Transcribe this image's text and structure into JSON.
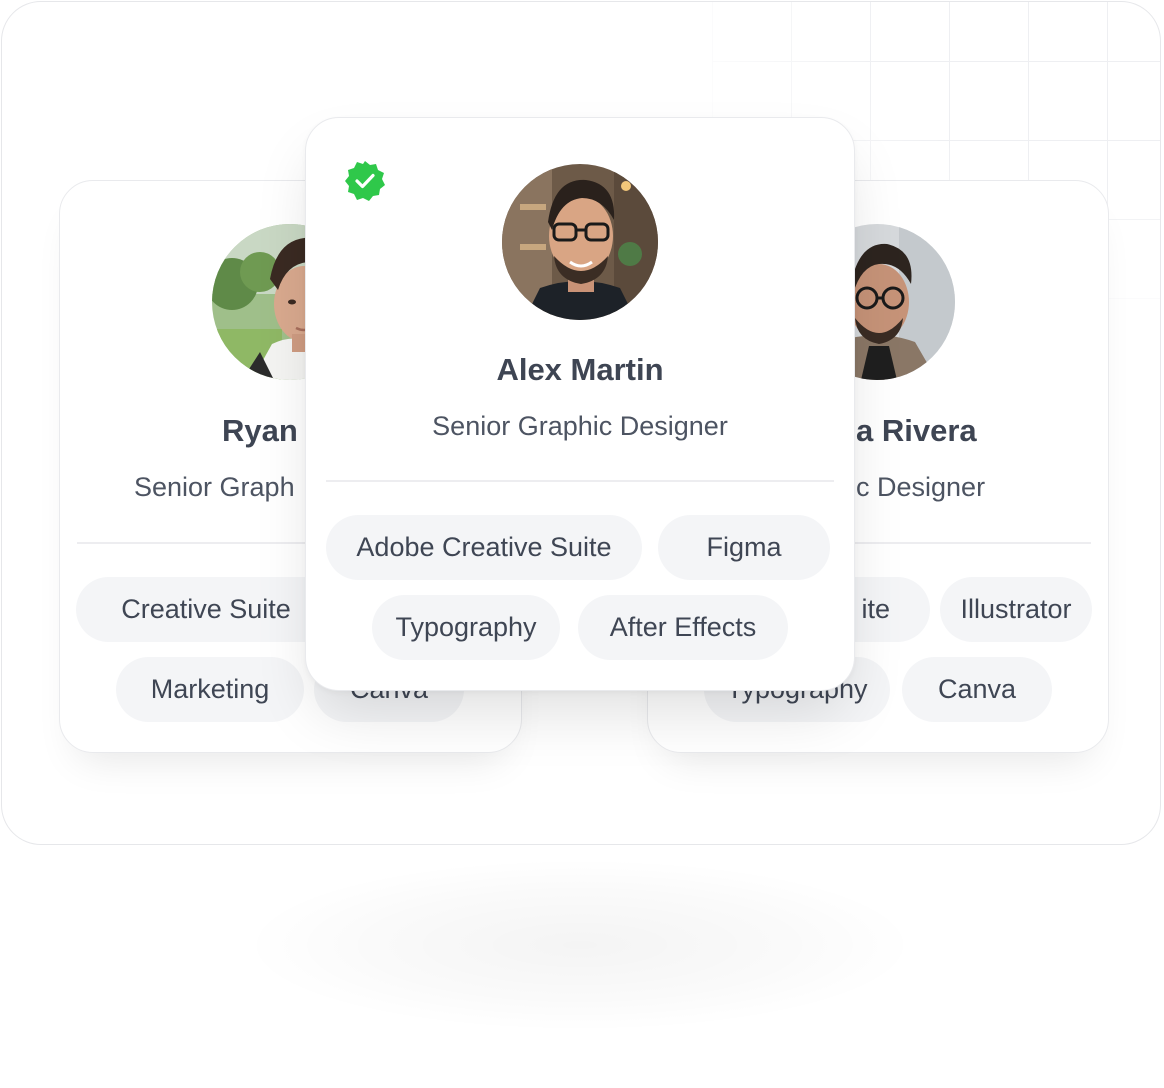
{
  "cards": {
    "left": {
      "name": "Ryan",
      "role": "Senior Graph",
      "skills": [
        "Creative Suite",
        "Marketing",
        "Canva"
      ]
    },
    "center": {
      "name": "Alex Martin",
      "role": "Senior Graphic Designer",
      "verified": true,
      "skills": [
        "Adobe Creative Suite",
        "Figma",
        "Typography",
        "After Effects"
      ]
    },
    "right": {
      "name": "a Rivera",
      "role": "c Designer",
      "skills": [
        "ite",
        "Illustrator",
        "Typography",
        "Canva"
      ]
    }
  },
  "colors": {
    "verified_badge": "#2fc84a",
    "chip_bg": "#f4f5f7",
    "text": "#3e4553"
  },
  "icons": {
    "verified": "verified-check-badge-icon"
  }
}
